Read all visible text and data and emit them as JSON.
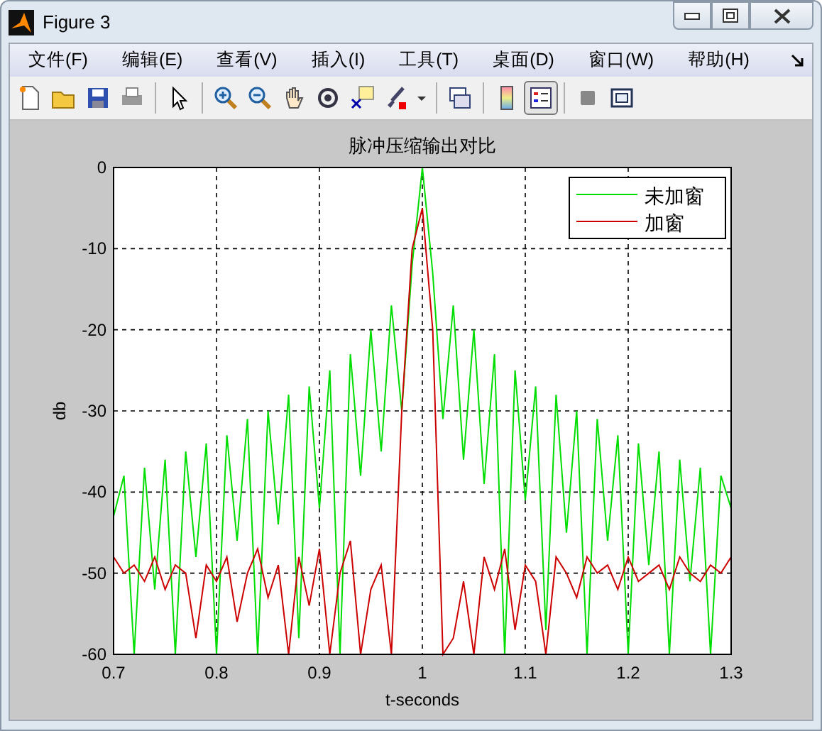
{
  "window": {
    "title": "Figure 3"
  },
  "menu": [
    {
      "label": "文件(F)"
    },
    {
      "label": "编辑(E)"
    },
    {
      "label": "查看(V)"
    },
    {
      "label": "插入(I)"
    },
    {
      "label": "工具(T)"
    },
    {
      "label": "桌面(D)"
    },
    {
      "label": "窗口(W)"
    },
    {
      "label": "帮助(H)"
    }
  ],
  "toolbar": [
    {
      "kind": "new",
      "selected": false
    },
    {
      "kind": "open",
      "selected": false
    },
    {
      "kind": "save",
      "selected": false
    },
    {
      "kind": "print",
      "selected": false
    },
    {
      "kind": "separator"
    },
    {
      "kind": "pointer",
      "selected": false
    },
    {
      "kind": "separator"
    },
    {
      "kind": "zoomin",
      "selected": false
    },
    {
      "kind": "zoomout",
      "selected": false
    },
    {
      "kind": "pan",
      "selected": false
    },
    {
      "kind": "rotate",
      "selected": false
    },
    {
      "kind": "cursor",
      "selected": false
    },
    {
      "kind": "brush",
      "selected": false
    },
    {
      "kind": "dropdown",
      "selected": false
    },
    {
      "kind": "separator"
    },
    {
      "kind": "link",
      "selected": false
    },
    {
      "kind": "separator"
    },
    {
      "kind": "colorbar",
      "selected": false
    },
    {
      "kind": "legend",
      "selected": true
    },
    {
      "kind": "separator"
    },
    {
      "kind": "hide",
      "selected": false
    },
    {
      "kind": "show",
      "selected": false
    }
  ],
  "axes": {
    "chart_data": {
      "type": "line",
      "title": "脉冲压缩输出对比",
      "xlabel": "t-seconds",
      "ylabel": "db",
      "xlim": [
        0.7,
        1.3
      ],
      "ylim": [
        -60,
        0
      ],
      "grid": true,
      "legend": true,
      "xticks": [
        {
          "value": 0.7,
          "label": "0.7"
        },
        {
          "value": 0.8,
          "label": "0.8"
        },
        {
          "value": 0.9,
          "label": "0.9"
        },
        {
          "value": 1,
          "label": "1"
        },
        {
          "value": 1.1,
          "label": "1.1"
        },
        {
          "value": 1.2,
          "label": "1.2"
        },
        {
          "value": 1.3,
          "label": "1.3"
        }
      ],
      "yticks": [
        {
          "value": 0,
          "label": "0"
        },
        {
          "value": -10,
          "label": "-10"
        },
        {
          "value": -20,
          "label": "-20"
        },
        {
          "value": -30,
          "label": "-30"
        },
        {
          "value": -40,
          "label": "-40"
        },
        {
          "value": -50,
          "label": "-50"
        },
        {
          "value": -60,
          "label": "-60"
        }
      ],
      "x": [
        0.7,
        0.71,
        0.72,
        0.73,
        0.74,
        0.75,
        0.76,
        0.77,
        0.78,
        0.79,
        0.8,
        0.81,
        0.82,
        0.83,
        0.84,
        0.85,
        0.86,
        0.87,
        0.88,
        0.89,
        0.9,
        0.91,
        0.92,
        0.93,
        0.94,
        0.95,
        0.96,
        0.97,
        0.98,
        0.99,
        1,
        1.01,
        1.02,
        1.03,
        1.04,
        1.05,
        1.06,
        1.07,
        1.08,
        1.09,
        1.1,
        1.11,
        1.12,
        1.13,
        1.14,
        1.15,
        1.16,
        1.17,
        1.18,
        1.19,
        1.2,
        1.21,
        1.22,
        1.23,
        1.24,
        1.25,
        1.26,
        1.27,
        1.28,
        1.29,
        1.3
      ],
      "series": [
        {
          "name": "未加窗",
          "color": "#00dd00",
          "values": [
            -43,
            -38,
            -60,
            -37,
            -52,
            -36,
            -60,
            -35,
            -48,
            -34,
            -60,
            -33,
            -46,
            -31,
            -60,
            -30,
            -44,
            -28,
            -58,
            -27,
            -42,
            -25,
            -60,
            -23,
            -38,
            -20,
            -35,
            -17,
            -30,
            -12,
            0,
            -13,
            -31,
            -17,
            -36,
            -20,
            -39,
            -23,
            -60,
            -25,
            -41,
            -27,
            -57,
            -28,
            -45,
            -30,
            -60,
            -31,
            -46,
            -33,
            -60,
            -34,
            -49,
            -35,
            -60,
            -36,
            -51,
            -37,
            -60,
            -38,
            -42
          ]
        },
        {
          "name": "加窗",
          "color": "#cc0000",
          "values": [
            -48,
            -50,
            -49,
            -51,
            -48,
            -52,
            -49,
            -50,
            -58,
            -49,
            -51,
            -48,
            -56,
            -50,
            -47,
            -53,
            -49,
            -60,
            -48,
            -54,
            -47,
            -60,
            -50,
            -46,
            -60,
            -52,
            -49,
            -60,
            -30,
            -10,
            -5,
            -20,
            -60,
            -58,
            -51,
            -60,
            -48,
            -52,
            -47,
            -57,
            -49,
            -51,
            -60,
            -48,
            -50,
            -53,
            -48,
            -50,
            -49,
            -52,
            -48,
            -51,
            -50,
            -49,
            -52,
            -48,
            -50,
            -51,
            -49,
            -50,
            -48
          ]
        }
      ]
    }
  }
}
